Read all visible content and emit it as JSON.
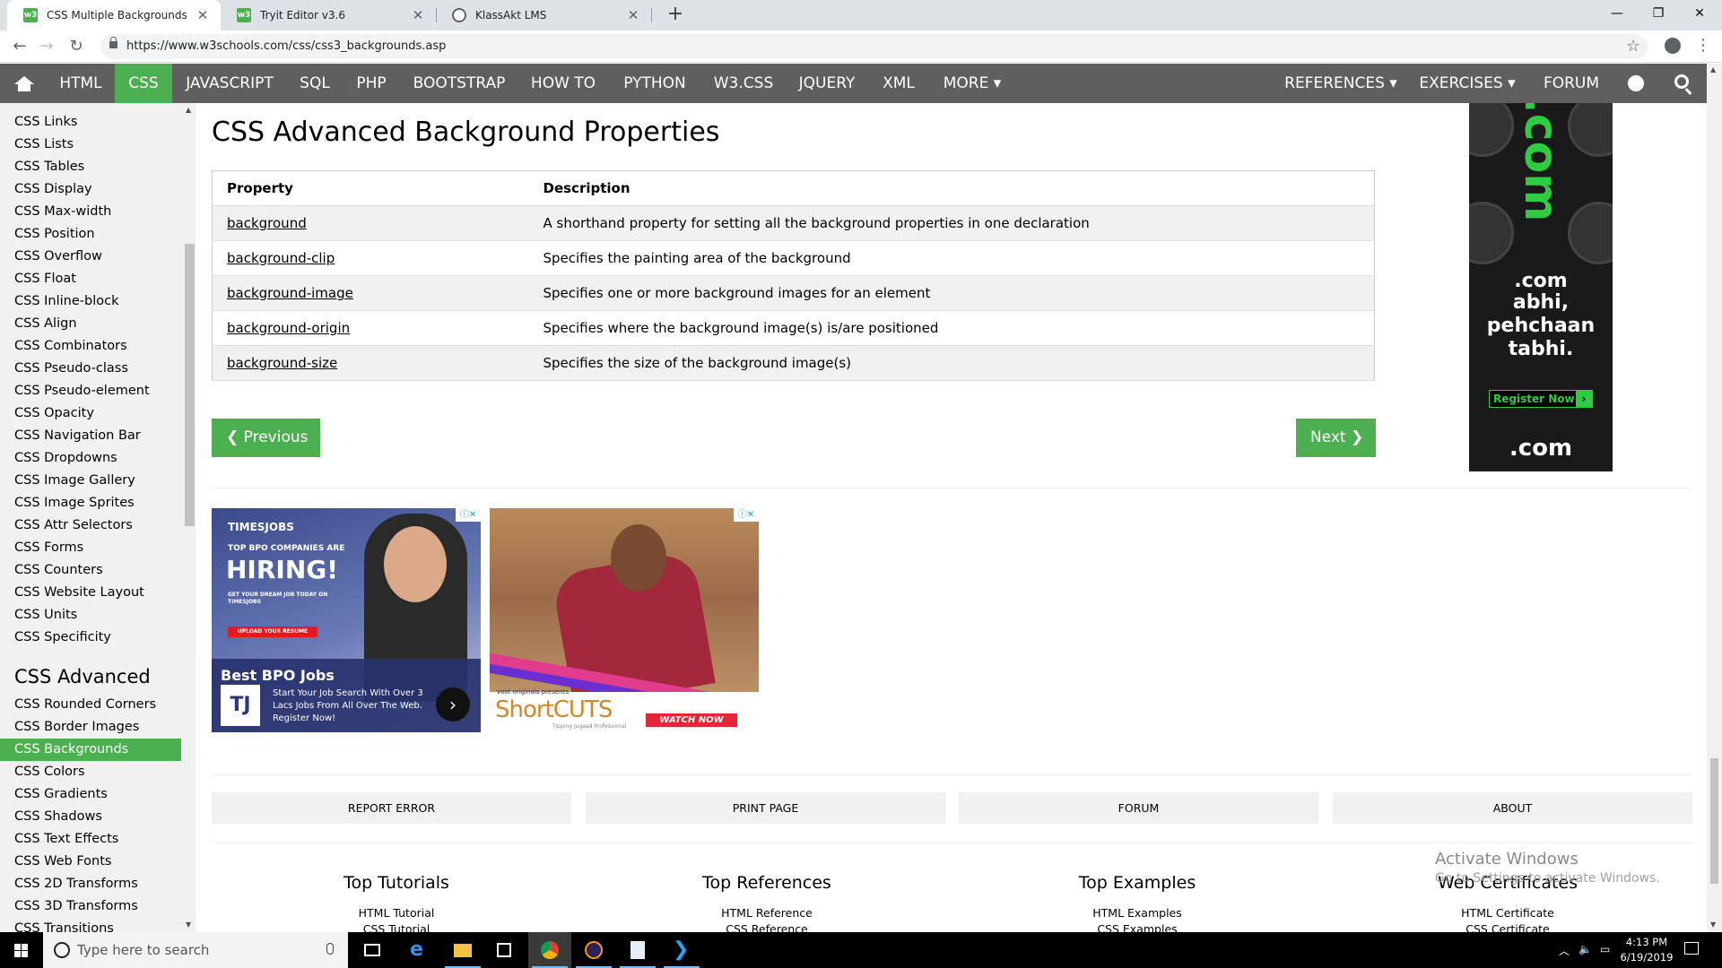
{
  "browser": {
    "tabs": [
      {
        "title": "CSS Multiple Backgrounds",
        "icon": "w3schools-icon",
        "active": true
      },
      {
        "title": "Tryit Editor v3.6",
        "icon": "w3schools-icon",
        "active": false
      },
      {
        "title": "KlassAkt LMS",
        "icon": "globe-icon",
        "active": false
      }
    ],
    "url": "https://www.w3schools.com/css/css3_backgrounds.asp"
  },
  "topnav": {
    "items": [
      "HTML",
      "CSS",
      "JAVASCRIPT",
      "SQL",
      "PHP",
      "BOOTSTRAP",
      "HOW TO",
      "PYTHON",
      "W3.CSS",
      "JQUERY",
      "XML",
      "MORE ▾"
    ],
    "active": "CSS",
    "right_items": [
      "REFERENCES ▾",
      "EXERCISES ▾",
      "FORUM"
    ]
  },
  "sidebar": {
    "items_top": [
      "CSS Links",
      "CSS Lists",
      "CSS Tables",
      "CSS Display",
      "CSS Max-width",
      "CSS Position",
      "CSS Overflow",
      "CSS Float",
      "CSS Inline-block",
      "CSS Align",
      "CSS Combinators",
      "CSS Pseudo-class",
      "CSS Pseudo-element",
      "CSS Opacity",
      "CSS Navigation Bar",
      "CSS Dropdowns",
      "CSS Image Gallery",
      "CSS Image Sprites",
      "CSS Attr Selectors",
      "CSS Forms",
      "CSS Counters",
      "CSS Website Layout",
      "CSS Units",
      "CSS Specificity"
    ],
    "heading": "CSS Advanced",
    "items_advanced": [
      "CSS Rounded Corners",
      "CSS Border Images",
      "CSS Backgrounds",
      "CSS Colors",
      "CSS Gradients",
      "CSS Shadows",
      "CSS Text Effects",
      "CSS Web Fonts",
      "CSS 2D Transforms",
      "CSS 3D Transforms",
      "CSS Transitions"
    ],
    "active": "CSS Backgrounds"
  },
  "main": {
    "title": "CSS Advanced Background Properties",
    "table": {
      "headers": [
        "Property",
        "Description"
      ],
      "rows": [
        [
          "background",
          "A shorthand property for setting all the background properties in one declaration"
        ],
        [
          "background-clip",
          "Specifies the painting area of the background"
        ],
        [
          "background-image",
          "Specifies one or more background images for an element"
        ],
        [
          "background-origin",
          "Specifies where the background image(s) is/are positioned"
        ],
        [
          "background-size",
          "Specifies the size of the background image(s)"
        ]
      ]
    },
    "prev_label": "❮ Previous",
    "next_label": "Next ❯"
  },
  "ads": {
    "badge": "ⓘ✕",
    "times": {
      "brand": "TIMESJOBS",
      "sub": "TOP BPO COMPANIES ARE",
      "big": "HIRING!",
      "small": "GET YOUR DREAM JOB TODAY ON TIMESJOBS",
      "upload": "UPLOAD YOUR RESUME",
      "strip_title": "Best BPO Jobs",
      "logo": "TJ",
      "strip_text": "Start Your Job Search With Over 3 Lacs Jobs From All Over The Web. Register Now!"
    },
    "voot": {
      "presents": "voot originals presents",
      "show": "ShortCUTS",
      "tagline": "Tipping Jugaad Professional",
      "watch": "WATCH NOW"
    },
    "dotcom": {
      "big": ".com",
      "line1": ".com",
      "line2": "abhi,",
      "line3": "pehchaan",
      "line4": "tabhi.",
      "register": "Register Now",
      "foot": ".com"
    }
  },
  "footer": {
    "buttons": [
      "REPORT ERROR",
      "PRINT PAGE",
      "FORUM",
      "ABOUT"
    ],
    "columns": [
      {
        "title": "Top Tutorials",
        "links": [
          "HTML Tutorial",
          "CSS Tutorial"
        ]
      },
      {
        "title": "Top References",
        "links": [
          "HTML Reference",
          "CSS Reference"
        ]
      },
      {
        "title": "Top Examples",
        "links": [
          "HTML Examples",
          "CSS Examples"
        ]
      },
      {
        "title": "Web Certificates",
        "links": [
          "HTML Certificate",
          "CSS Certificate"
        ]
      }
    ]
  },
  "watermark": {
    "line1": "Activate Windows",
    "line2": "Go to Settings to activate Windows."
  },
  "taskbar": {
    "search_placeholder": "Type here to search",
    "time": "4:13 PM",
    "date": "6/19/2019"
  },
  "colors": {
    "w3_green": "#4caf50",
    "nav_gray": "#5f5f5f",
    "sidebar_bg": "#f1f1f1"
  }
}
